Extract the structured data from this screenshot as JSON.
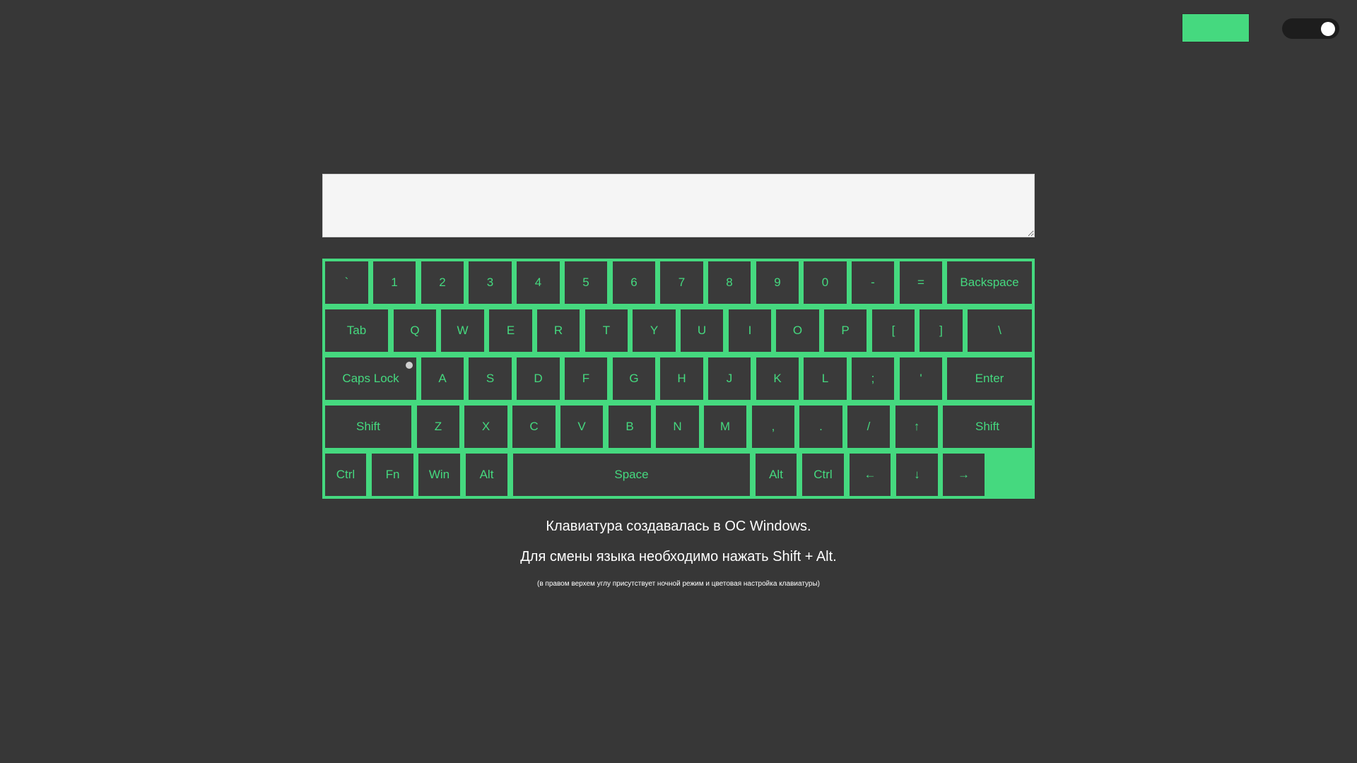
{
  "theme": {
    "background": "#373737",
    "accent": "#45d97f",
    "key_background": "#3a3a3a",
    "toggle_track": "#1d1d1d",
    "toggle_knob": "#ffffff"
  },
  "header": {
    "color_picker": {
      "icon": "color-swatch",
      "value": "#45d97f"
    },
    "night_mode_toggle": {
      "icon": "toggle-switch",
      "state": "on"
    }
  },
  "textarea": {
    "value": "",
    "placeholder": ""
  },
  "keyboard": {
    "caps_lock_indicator": "off",
    "rows": [
      [
        "`",
        "1",
        "2",
        "3",
        "4",
        "5",
        "6",
        "7",
        "8",
        "9",
        "0",
        "-",
        "=",
        "Backspace"
      ],
      [
        "Tab",
        "Q",
        "W",
        "E",
        "R",
        "T",
        "Y",
        "U",
        "I",
        "O",
        "P",
        "[",
        "]",
        "\\"
      ],
      [
        "Caps Lock",
        "A",
        "S",
        "D",
        "F",
        "G",
        "H",
        "J",
        "K",
        "L",
        ";",
        "'",
        "Enter"
      ],
      [
        "Shift",
        "Z",
        "X",
        "C",
        "V",
        "B",
        "N",
        "M",
        ",",
        ".",
        "/",
        "↑",
        "Shift"
      ],
      [
        "Ctrl",
        "Fn",
        "Win",
        "Alt",
        "Space",
        "Alt",
        "Ctrl",
        "←",
        "↓",
        "→"
      ]
    ]
  },
  "info": {
    "line1": "Клавиатура создавалась в ОС Windows.",
    "line2": "Для смены языка необходимо нажать Shift + Alt.",
    "note": "(в правом верхем углу присутствует ночной режим и цветовая настройка клавиатуры)"
  }
}
